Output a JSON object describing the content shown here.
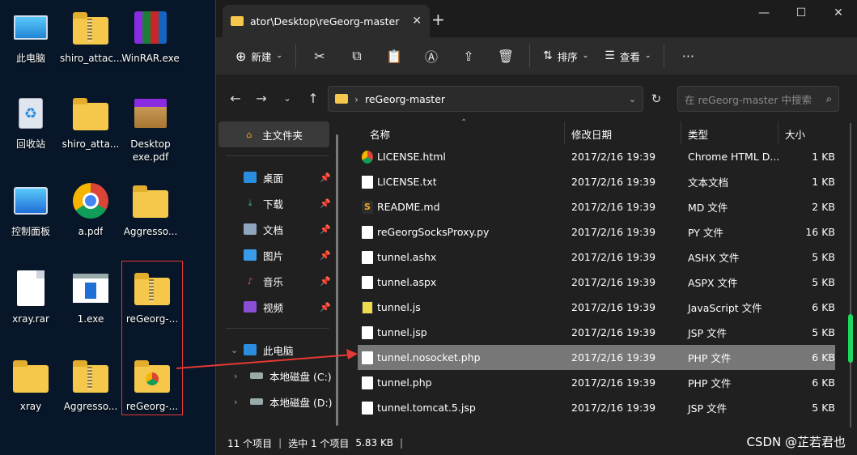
{
  "desktop": {
    "icons": [
      {
        "label": "此电脑",
        "icon": "monitor-icon"
      },
      {
        "label": "shiro_attac...",
        "icon": "zip-folder-icon"
      },
      {
        "label": "WinRAR.exe",
        "icon": "winrar-icon"
      },
      {
        "label": "回收站",
        "icon": "recycle-bin-icon"
      },
      {
        "label": "shiro_atta...",
        "icon": "folder-icon"
      },
      {
        "label": "Desktop exe.pdf",
        "icon": "winrar-box-icon"
      },
      {
        "label": "控制面板",
        "icon": "control-panel-icon"
      },
      {
        "label": "a.pdf",
        "icon": "chrome-icon"
      },
      {
        "label": "Aggresso...",
        "icon": "folder-icon"
      },
      {
        "label": "xray.rar",
        "icon": "document-icon"
      },
      {
        "label": "1.exe",
        "icon": "exe-icon"
      },
      {
        "label": "reGeorg-...",
        "icon": "zip-folder-icon"
      },
      {
        "label": "xray",
        "icon": "folder-icon"
      },
      {
        "label": "Aggresso...",
        "icon": "zip-folder-icon"
      },
      {
        "label": "reGeorg-...",
        "icon": "chrome-folder-icon"
      }
    ]
  },
  "explorer": {
    "tab_title": "ator\\Desktop\\reGeorg-master",
    "toolbar": {
      "new_label": "新建",
      "sort_label": "排序",
      "view_label": "查看"
    },
    "address": {
      "path": "reGeorg-master",
      "search_placeholder": "在 reGeorg-master 中搜索"
    },
    "sidebar": {
      "home": "主文件夹",
      "items": [
        {
          "label": "桌面"
        },
        {
          "label": "下载"
        },
        {
          "label": "文档"
        },
        {
          "label": "图片"
        },
        {
          "label": "音乐"
        },
        {
          "label": "视频"
        }
      ],
      "this_pc": "此电脑",
      "drives": [
        {
          "label": "本地磁盘 (C:)"
        },
        {
          "label": "本地磁盘 (D:)"
        }
      ]
    },
    "columns": {
      "name": "名称",
      "date": "修改日期",
      "type": "类型",
      "size": "大小"
    },
    "files": [
      {
        "name": "LICENSE.html",
        "date": "2017/2/16 19:39",
        "type": "Chrome HTML D...",
        "size": "1 KB",
        "icon": "chrome"
      },
      {
        "name": "LICENSE.txt",
        "date": "2017/2/16 19:39",
        "type": "文本文档",
        "size": "1 KB",
        "icon": "txt"
      },
      {
        "name": "README.md",
        "date": "2017/2/16 19:39",
        "type": "MD 文件",
        "size": "2 KB",
        "icon": "md"
      },
      {
        "name": "reGeorgSocksProxy.py",
        "date": "2017/2/16 19:39",
        "type": "PY 文件",
        "size": "16 KB",
        "icon": "txt"
      },
      {
        "name": "tunnel.ashx",
        "date": "2017/2/16 19:39",
        "type": "ASHX 文件",
        "size": "5 KB",
        "icon": "txt"
      },
      {
        "name": "tunnel.aspx",
        "date": "2017/2/16 19:39",
        "type": "ASPX 文件",
        "size": "5 KB",
        "icon": "txt"
      },
      {
        "name": "tunnel.js",
        "date": "2017/2/16 19:39",
        "type": "JavaScript 文件",
        "size": "6 KB",
        "icon": "js"
      },
      {
        "name": "tunnel.jsp",
        "date": "2017/2/16 19:39",
        "type": "JSP 文件",
        "size": "5 KB",
        "icon": "txt"
      },
      {
        "name": "tunnel.nosocket.php",
        "date": "2017/2/16 19:39",
        "type": "PHP 文件",
        "size": "6 KB",
        "icon": "txt",
        "selected": true
      },
      {
        "name": "tunnel.php",
        "date": "2017/2/16 19:39",
        "type": "PHP 文件",
        "size": "6 KB",
        "icon": "txt"
      },
      {
        "name": "tunnel.tomcat.5.jsp",
        "date": "2017/2/16 19:39",
        "type": "JSP 文件",
        "size": "5 KB",
        "icon": "txt"
      }
    ],
    "status": {
      "count": "11 个项目",
      "selection": "选中 1 个项目",
      "size": "5.83 KB"
    }
  },
  "watermark": "CSDN @芷若君也",
  "colors": {
    "annotation": "#e53935",
    "selected_row": "#777777",
    "folder": "#f5c84c"
  }
}
